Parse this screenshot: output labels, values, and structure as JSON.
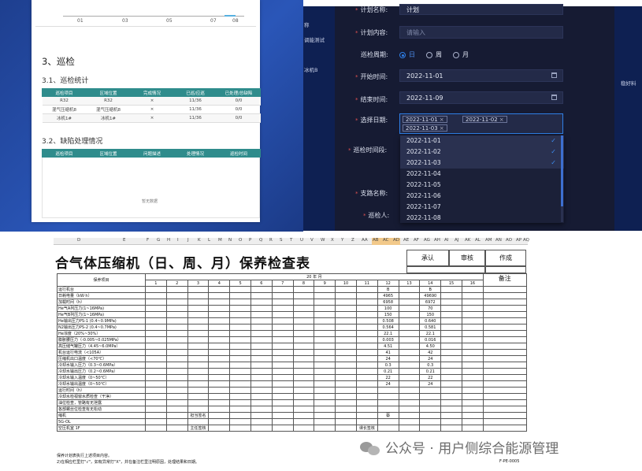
{
  "report": {
    "chart_ticks": [
      "01",
      "03",
      "05",
      "07",
      "08"
    ],
    "section_title": "3、巡检",
    "stats_title": "3.1、巡检统计",
    "stats_headers": [
      "巡检项目",
      "区域位置",
      "完成情况",
      "已巡/应巡",
      "已处理/总缺陷"
    ],
    "stats_rows": [
      [
        "R32",
        "R32",
        "×",
        "11/36",
        "0/0"
      ],
      [
        "混气压缩机8",
        "混气压缩机8",
        "×",
        "11/36",
        "0/0"
      ],
      [
        "冰机1#",
        "冰机1#",
        "×",
        "11/36",
        "0/0"
      ]
    ],
    "defects_title": "3.2、缺陷处理情况",
    "defects_headers": [
      "巡检项目",
      "区域位置",
      "问题描述",
      "处理情况",
      "巡检时间"
    ],
    "no_data": "暂无数据"
  },
  "side": {
    "left_labels": [
      "称",
      "调能测试",
      "冰机B"
    ],
    "right_label": "稳好料"
  },
  "form": {
    "plan_name_label": "计划名称:",
    "plan_name_value": "计划",
    "plan_content_label": "计划内容:",
    "plan_content_placeholder": "请输入",
    "cycle_label": "巡检周期:",
    "cycle_options": [
      "日",
      "周",
      "月"
    ],
    "cycle_selected": "日",
    "start_label": "开始时间:",
    "start_value": "2022-11-01",
    "end_label": "结束时间:",
    "end_value": "2022-11-09",
    "date_label": "选择日期:",
    "selected_dates": [
      "2022-11-01",
      "2022-11-02",
      "2022-11-03"
    ],
    "period_label": "巡检时间段:",
    "route_label": "支路名称:",
    "inspector_label": "巡检人:",
    "dropdown": [
      {
        "date": "2022-11-01",
        "checked": true
      },
      {
        "date": "2022-11-02",
        "checked": true
      },
      {
        "date": "2022-11-03",
        "checked": true
      },
      {
        "date": "2022-11-04",
        "checked": false
      },
      {
        "date": "2022-11-05",
        "checked": false
      },
      {
        "date": "2022-11-06",
        "checked": false
      },
      {
        "date": "2022-11-07",
        "checked": false
      },
      {
        "date": "2022-11-08",
        "checked": false
      }
    ]
  },
  "sheet": {
    "col_letters": [
      "D",
      "E",
      "F",
      "G",
      "H",
      "I",
      "J",
      "K",
      "L",
      "M",
      "N",
      "O",
      "P",
      "Q",
      "R",
      "S",
      "T",
      "U",
      "V",
      "W",
      "X",
      "Y",
      "Z",
      "AA",
      "AB",
      "AC",
      "AD",
      "AE",
      "AF",
      "AG",
      "AH",
      "AI",
      "AJ",
      "AK",
      "AL",
      "AM",
      "AN",
      "AO",
      "AP",
      "AQ"
    ],
    "title": "合气体压缩机（日、周、月）保养检查表",
    "approve": "承认",
    "review": "审核",
    "make": "作成",
    "item_header": "保养项目",
    "year_month": "20    年    月",
    "remark": "备注",
    "days": [
      "1",
      "2",
      "3",
      "4",
      "5",
      "6",
      "7",
      "8",
      "9",
      "10",
      "11",
      "12",
      "13",
      "14",
      "15",
      "16"
    ],
    "rows": [
      {
        "name": "运行机台",
        "d12": "B",
        "d14": "B"
      },
      {
        "name": "日耗电量（kW·h）",
        "d12": "4965",
        "d14": "49690"
      },
      {
        "name": "加载时间（h）",
        "d12": "6958",
        "d14": "6972"
      },
      {
        "name": "He气A列压力(1~16MPa)",
        "d12": "100",
        "d14": "70"
      },
      {
        "name": "He气B列压力(1~16MPa)",
        "d12": "150",
        "d14": "150"
      },
      {
        "name": "He输出压力PS-1 (0.4~0.9MPa)",
        "d12": "0.508",
        "d14": "0.640"
      },
      {
        "name": "N2输出压力PS-2 (0.4~0.7MPa)",
        "d12": "0.564",
        "d14": "0.581"
      },
      {
        "name": "He浓度（20%~30%）",
        "d12": "22.1",
        "d14": "22.1"
      },
      {
        "name": "膨胀腰压力（-0.005~0.025MPa）",
        "d12": "0.003",
        "d14": "0.016"
      },
      {
        "name": "高压储气罐压力（4.45~6.0MPa）",
        "d12": "4.51",
        "d14": "4.50"
      },
      {
        "name": "机台运行电流（<105A）",
        "d12": "41",
        "d14": "42"
      },
      {
        "name": "压缩机出口温度（<70℃）",
        "d12": "24",
        "d14": "24"
      },
      {
        "name": "冷却水输入压力（0.3~0.6MPa）",
        "d12": "0.3",
        "d14": "0.3"
      },
      {
        "name": "冷却水输出压力（0.2~0.6MPa）",
        "d12": "0.21",
        "d14": "0.21"
      },
      {
        "name": "冷却水输入温度（0~50℃）",
        "d12": "22",
        "d14": "22"
      },
      {
        "name": "冷却水输出温度（0~50℃）",
        "d12": "24",
        "d14": "24"
      },
      {
        "name": "运行时间（h）",
        "d12": "",
        "d14": ""
      },
      {
        "name": "冷却水检视窗水质检查（干净）",
        "d12": "",
        "d14": ""
      },
      {
        "name": "油位检查，管路有无泄露",
        "d12": "",
        "d14": ""
      },
      {
        "name": "各部螺丝位检查有无松动",
        "d12": "",
        "d14": ""
      }
    ],
    "lower_left": [
      "缩机",
      "5G-OL",
      "空压机室 1F"
    ],
    "exec_sign": "担当签名",
    "chief_sign": "主任签核",
    "section_sign": "课长签核",
    "stamp": "蔡",
    "footer1": "保养计划表执行上述项目内容。",
    "footer2": "2)在相应栏里打\"√\"，如有异常打\"X\"，并在备注栏里注明原因，处理结果和日期。",
    "form_no": "F-PE-0005"
  },
  "watermark": "公众号 · 用户侧综合能源管理"
}
